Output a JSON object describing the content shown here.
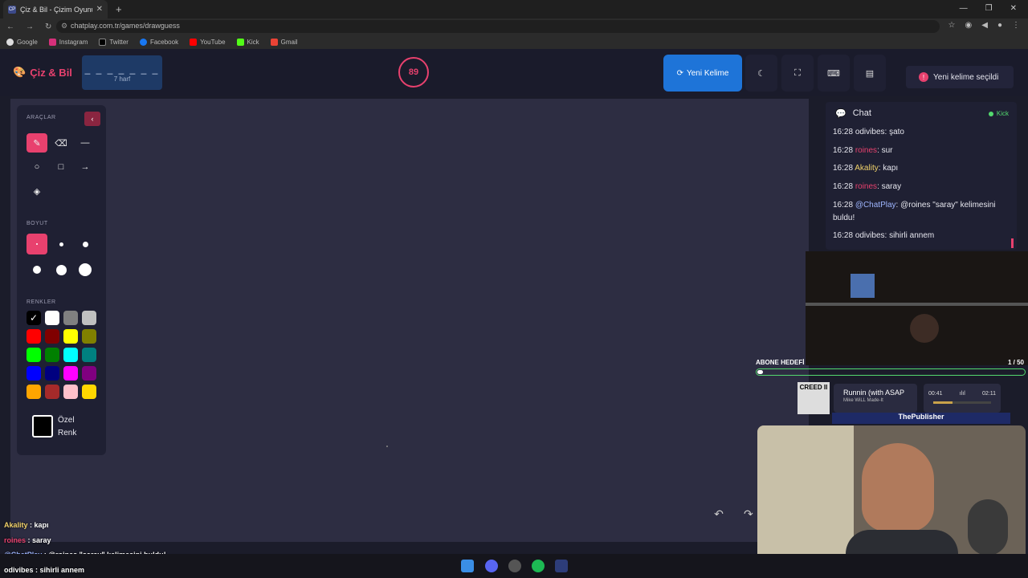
{
  "browser": {
    "tab_title": "Çiz & Bil - Çizim Oyunu",
    "tab_favicon": "CP",
    "url": "chatplay.com.tr/games/drawguess",
    "bookmarks": [
      "Google",
      "Instagram",
      "Twitter",
      "Facebook",
      "YouTube",
      "Kick",
      "Gmail"
    ]
  },
  "header": {
    "logo": "Çiz & Bil",
    "word_dashes": "_ _ _ _ _ _ _",
    "word_length": "7 harf",
    "timer": "89",
    "new_word_button": "Yeni Kelime",
    "toast": "Yeni kelime seçildi"
  },
  "tools": {
    "tools_label": "ARAÇLAR",
    "size_label": "BOYUT",
    "colors_label": "RENKLER",
    "custom_color": "Özel Renk",
    "colors": [
      "#000000",
      "#ffffff",
      "#808080",
      "#c0c0c0",
      "#ff0000",
      "#800000",
      "#ffff00",
      "#808000",
      "#00ff00",
      "#008000",
      "#00ffff",
      "#008080",
      "#0000ff",
      "#000080",
      "#ff00ff",
      "#800080",
      "#ffa500",
      "#a52a2a",
      "#ffc0cb",
      "#ffd700"
    ]
  },
  "chat": {
    "title": "Chat",
    "platform": "Kick",
    "messages": [
      {
        "time": "16:28",
        "user": "odivibes",
        "text": ": şato"
      },
      {
        "time": "16:28",
        "user": "roines",
        "text": ": sur"
      },
      {
        "time": "16:28",
        "user": "Akality",
        "text": ": kapı"
      },
      {
        "time": "16:28",
        "user": "roines",
        "text": ": saray"
      },
      {
        "time": "16:28",
        "user": "@ChatPlay",
        "text": ": @roines \"saray\" kelimesini buldu!"
      },
      {
        "time": "16:28",
        "user": "odivibes",
        "text": ": sihirli annem"
      }
    ]
  },
  "stream": {
    "abone_label": "ABONE HEDEFİ",
    "abone_count": "1 / 50",
    "abone_progress": 0.02,
    "song_title": "Runnin (with ASAP",
    "song_artist": "Mike WiLL Made-It",
    "album_text": "CREED II",
    "time_current": "00:41",
    "time_total": "02:11",
    "publisher": "ThePublisher"
  },
  "overlay_chat": [
    {
      "user": "Akality",
      "text": " : kapı"
    },
    {
      "user": "roines",
      "text": " : saray"
    },
    {
      "user": "@ChatPlay",
      "text": " : @roines \"saray\" kelimesini buldu!"
    },
    {
      "user": "odivibes",
      "text": " : sihirli annem"
    }
  ]
}
